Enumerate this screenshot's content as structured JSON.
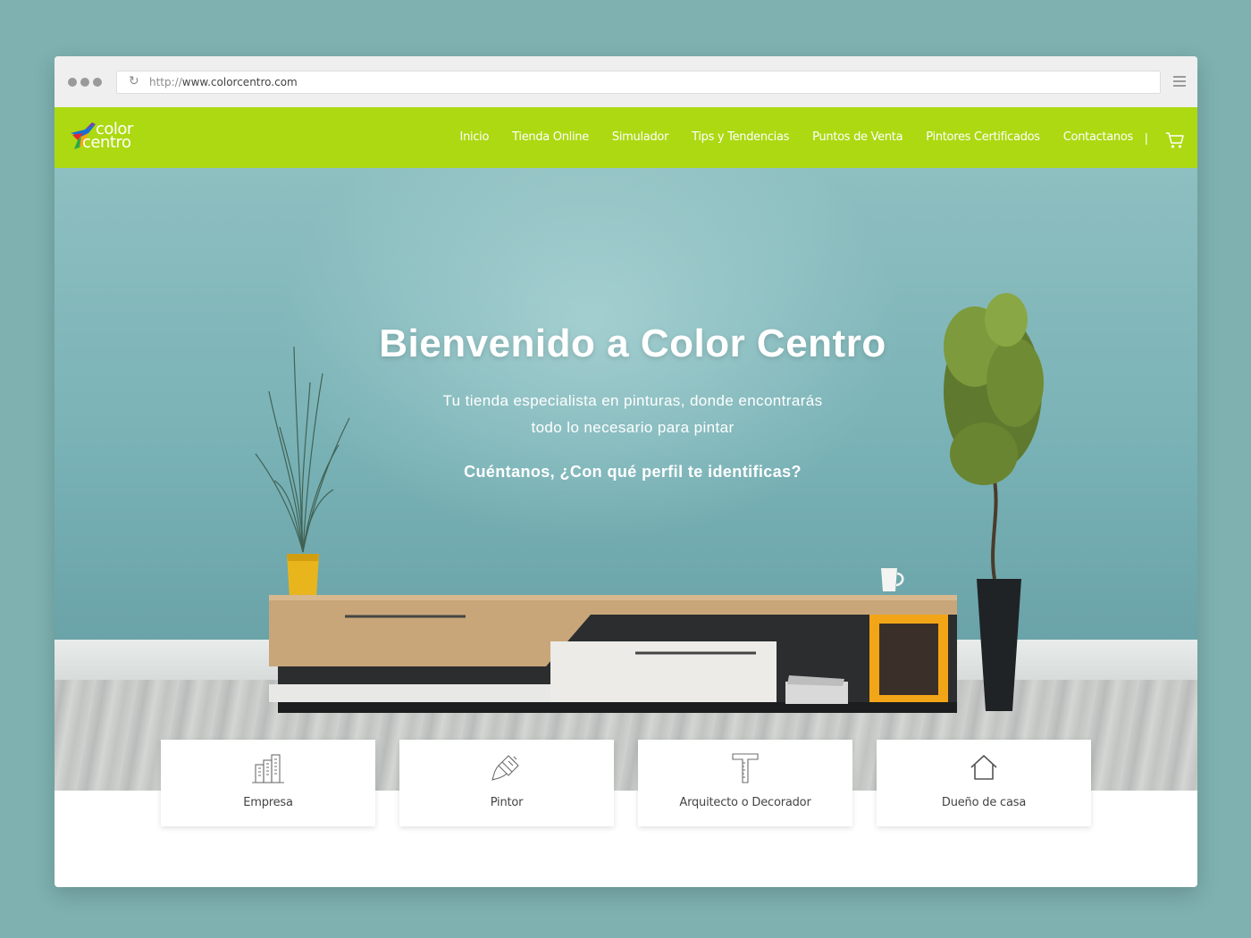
{
  "browser": {
    "url_protocol": "http://",
    "url_host": "www.colorcentro.com"
  },
  "logo": {
    "line1": "color",
    "line2": "centro"
  },
  "nav": {
    "items": [
      {
        "label": "Inicio"
      },
      {
        "label": "Tienda Online"
      },
      {
        "label": "Simulador"
      },
      {
        "label": "Tips y Tendencias"
      },
      {
        "label": "Puntos de Venta"
      },
      {
        "label": "Pintores Certificados"
      },
      {
        "label": "Contactanos"
      }
    ],
    "separator": "|",
    "cart_icon": "shopping-cart-icon"
  },
  "hero": {
    "title": "Bienvenido a Color Centro",
    "subtitle_line1": "Tu tienda especialista en pinturas, donde encontrarás",
    "subtitle_line2": "todo lo necesario para pintar",
    "question": "Cuéntanos, ¿Con qué perfil te identificas?"
  },
  "profiles": [
    {
      "label": "Empresa",
      "icon": "building-icon"
    },
    {
      "label": "Pintor",
      "icon": "paint-brush-icon"
    },
    {
      "label": "Arquitecto o Decorador",
      "icon": "t-square-icon"
    },
    {
      "label": "Dueño de casa",
      "icon": "house-icon"
    }
  ],
  "colors": {
    "navbar": "#acd911",
    "background": "#7eb1b0",
    "wall": "#79b2b6"
  }
}
